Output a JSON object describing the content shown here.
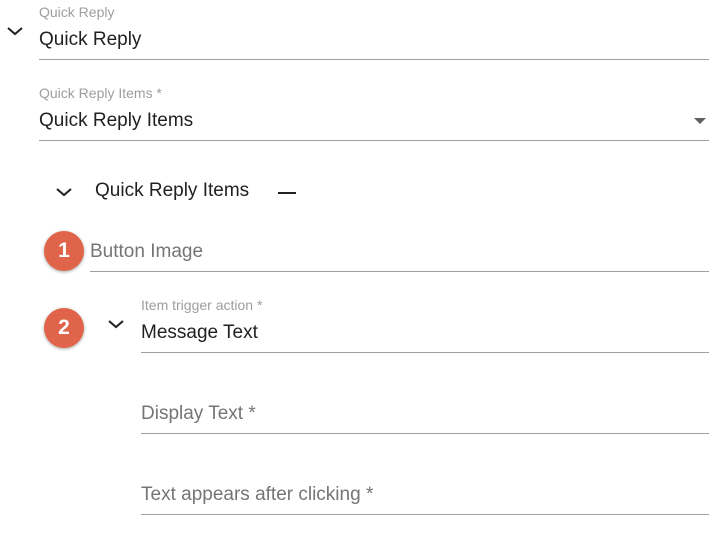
{
  "quick_reply": {
    "label": "Quick Reply",
    "value": "Quick Reply"
  },
  "quick_reply_items_select": {
    "label": "Quick Reply Items *",
    "value": "Quick Reply Items"
  },
  "quick_reply_items_section": {
    "title": "Quick Reply Items"
  },
  "button_image": {
    "badge": "1",
    "placeholder": "Button Image"
  },
  "item_trigger": {
    "badge": "2",
    "label": "Item trigger action *",
    "value": "Message Text"
  },
  "display_text": {
    "placeholder": "Display Text *"
  },
  "text_after_click": {
    "placeholder": "Text appears after clicking *"
  },
  "colors": {
    "badge": "#e0644a",
    "underline": "#9e9e9e",
    "label": "#9e9e9e"
  }
}
